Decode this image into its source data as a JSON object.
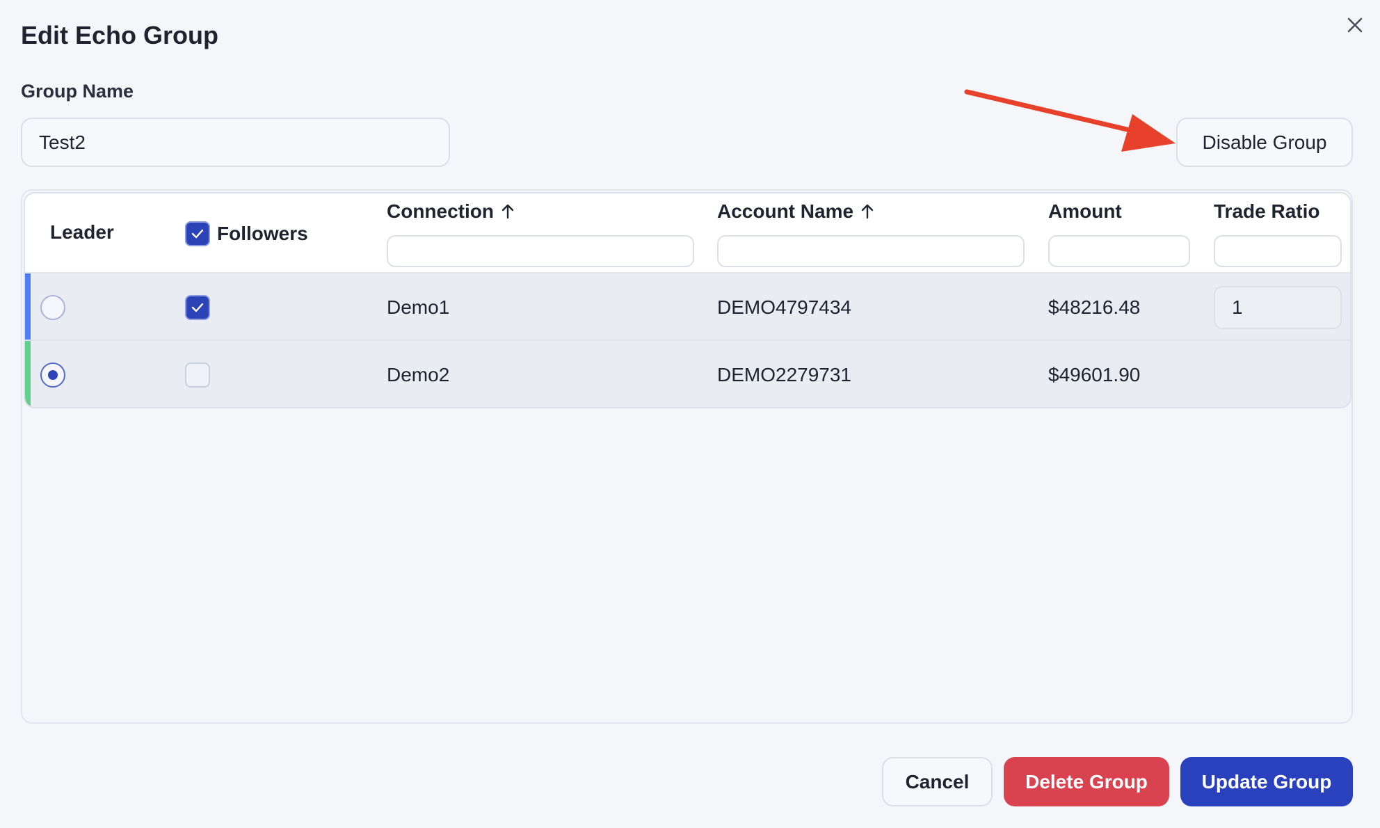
{
  "dialog": {
    "title": "Edit Echo Group",
    "close_icon": "close-icon"
  },
  "group": {
    "label": "Group Name",
    "value": "Test2",
    "disable_label": "Disable Group"
  },
  "table": {
    "columns": {
      "leader": "Leader",
      "followers": "Followers",
      "connection": "Connection",
      "account_name": "Account Name",
      "amount": "Amount",
      "trade_ratio": "Trade Ratio"
    },
    "header_followers_checked": true,
    "sort_icons": [
      "arrow-up-icon",
      "arrow-up-icon"
    ],
    "rows": [
      {
        "leader": false,
        "follower": true,
        "connection": "Demo1",
        "account": "DEMO4797434",
        "amount": "$48216.48",
        "trade_ratio": "1",
        "accent": "#4f7df5"
      },
      {
        "leader": true,
        "follower": false,
        "connection": "Demo2",
        "account": "DEMO2279731",
        "amount": "$49601.90",
        "trade_ratio": "",
        "accent": "#5fd08e"
      }
    ]
  },
  "footer": {
    "cancel": "Cancel",
    "delete": "Delete Group",
    "update": "Update Group"
  },
  "colors": {
    "primary": "#2a41bd",
    "danger": "#d9434f",
    "annotation_arrow": "#e8412b"
  }
}
